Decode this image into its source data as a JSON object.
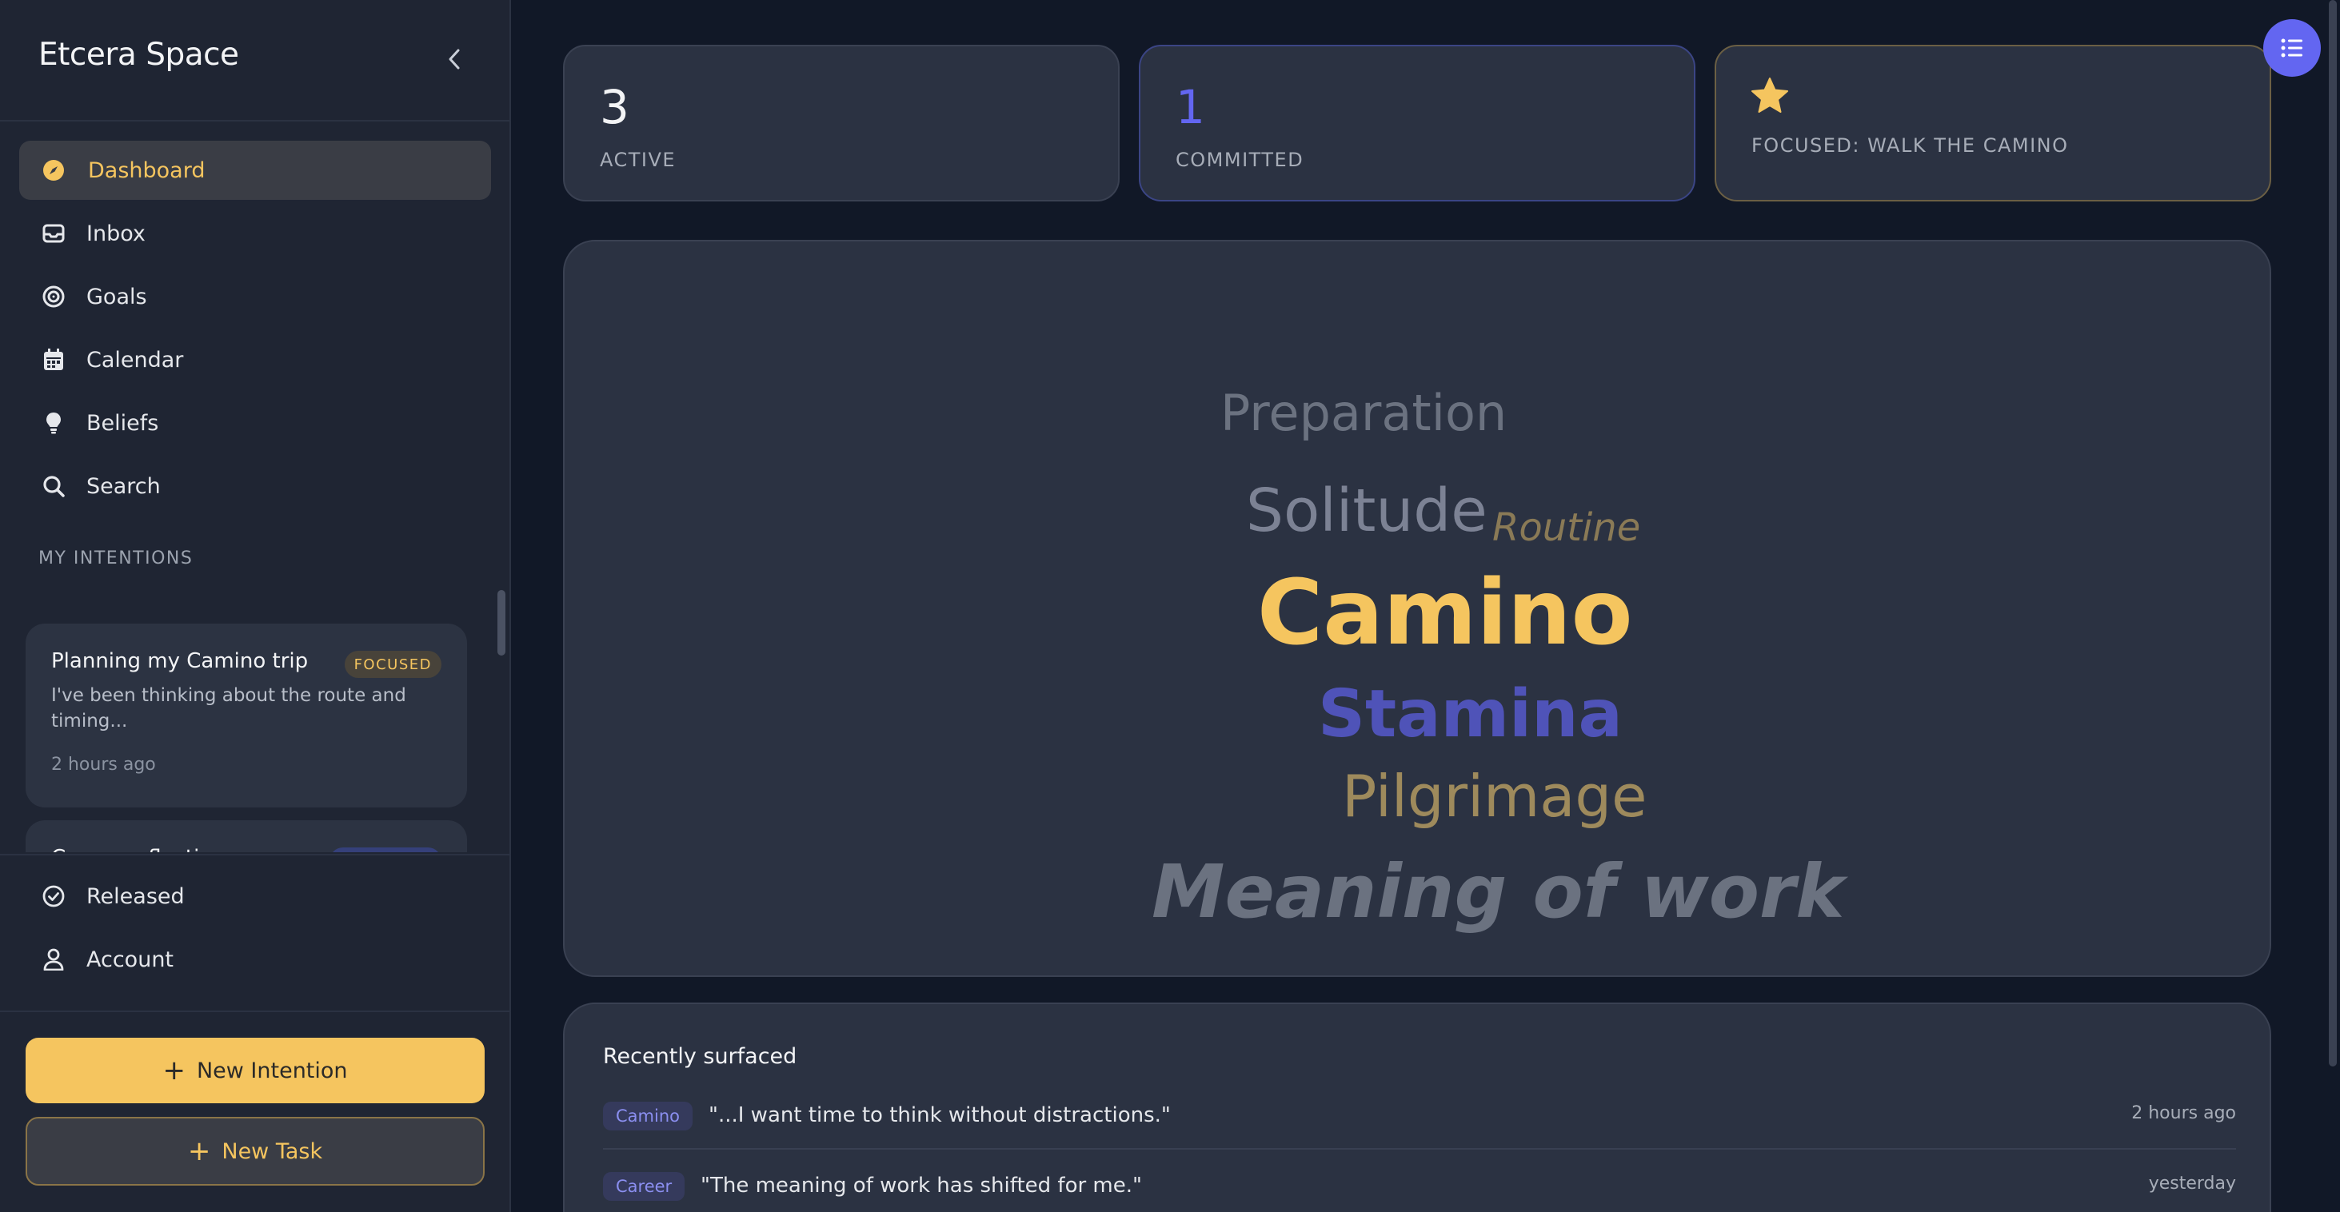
{
  "app": {
    "title": "Etcera Space"
  },
  "colors": {
    "accent": "#f5c55f",
    "indigo": "#6366f1",
    "background": "#111827",
    "sidebar": "#1f2533",
    "card": "#2b3242"
  },
  "sidebar": {
    "collapse_icon": "chevron-left-icon",
    "nav": [
      {
        "label": "Dashboard",
        "icon": "compass-icon",
        "active": true
      },
      {
        "label": "Inbox",
        "icon": "inbox-icon"
      },
      {
        "label": "Goals",
        "icon": "target-icon"
      },
      {
        "label": "Calendar",
        "icon": "calendar-icon"
      },
      {
        "label": "Beliefs",
        "icon": "lightbulb-icon"
      },
      {
        "label": "Search",
        "icon": "search-icon"
      }
    ],
    "section_label": "MY INTENTIONS",
    "intentions": [
      {
        "title": "Planning my Camino trip",
        "badge": "FOCUSED",
        "snippet": "I've been thinking about the route and timing...",
        "time": "2 hours ago"
      },
      {
        "title": "Career reflection"
      }
    ],
    "bottom_nav": [
      {
        "label": "Released",
        "icon": "check-circle-icon"
      },
      {
        "label": "Account",
        "icon": "user-icon"
      }
    ],
    "new_intention": "New Intention",
    "new_task": "New Task"
  },
  "stats": {
    "active": {
      "value": "3",
      "label": "ACTIVE"
    },
    "committed": {
      "value": "1",
      "label": "COMMITTED"
    },
    "focused": {
      "label": "FOCUSED: WALK THE CAMINO",
      "icon": "star-icon"
    }
  },
  "fab_icon": "list-icon",
  "word_cloud": [
    "Preparation",
    "Solitude",
    "Routine",
    "Camino",
    "Stamina",
    "Pilgrimage",
    "Meaning of work"
  ],
  "recent": {
    "title": "Recently surfaced",
    "items": [
      {
        "tag": "Camino",
        "quote": "\"...I want time to think without distractions.\"",
        "time": "2 hours ago"
      },
      {
        "tag": "Career",
        "quote": "\"The meaning of work has shifted for me.\"",
        "time": "yesterday"
      }
    ]
  }
}
